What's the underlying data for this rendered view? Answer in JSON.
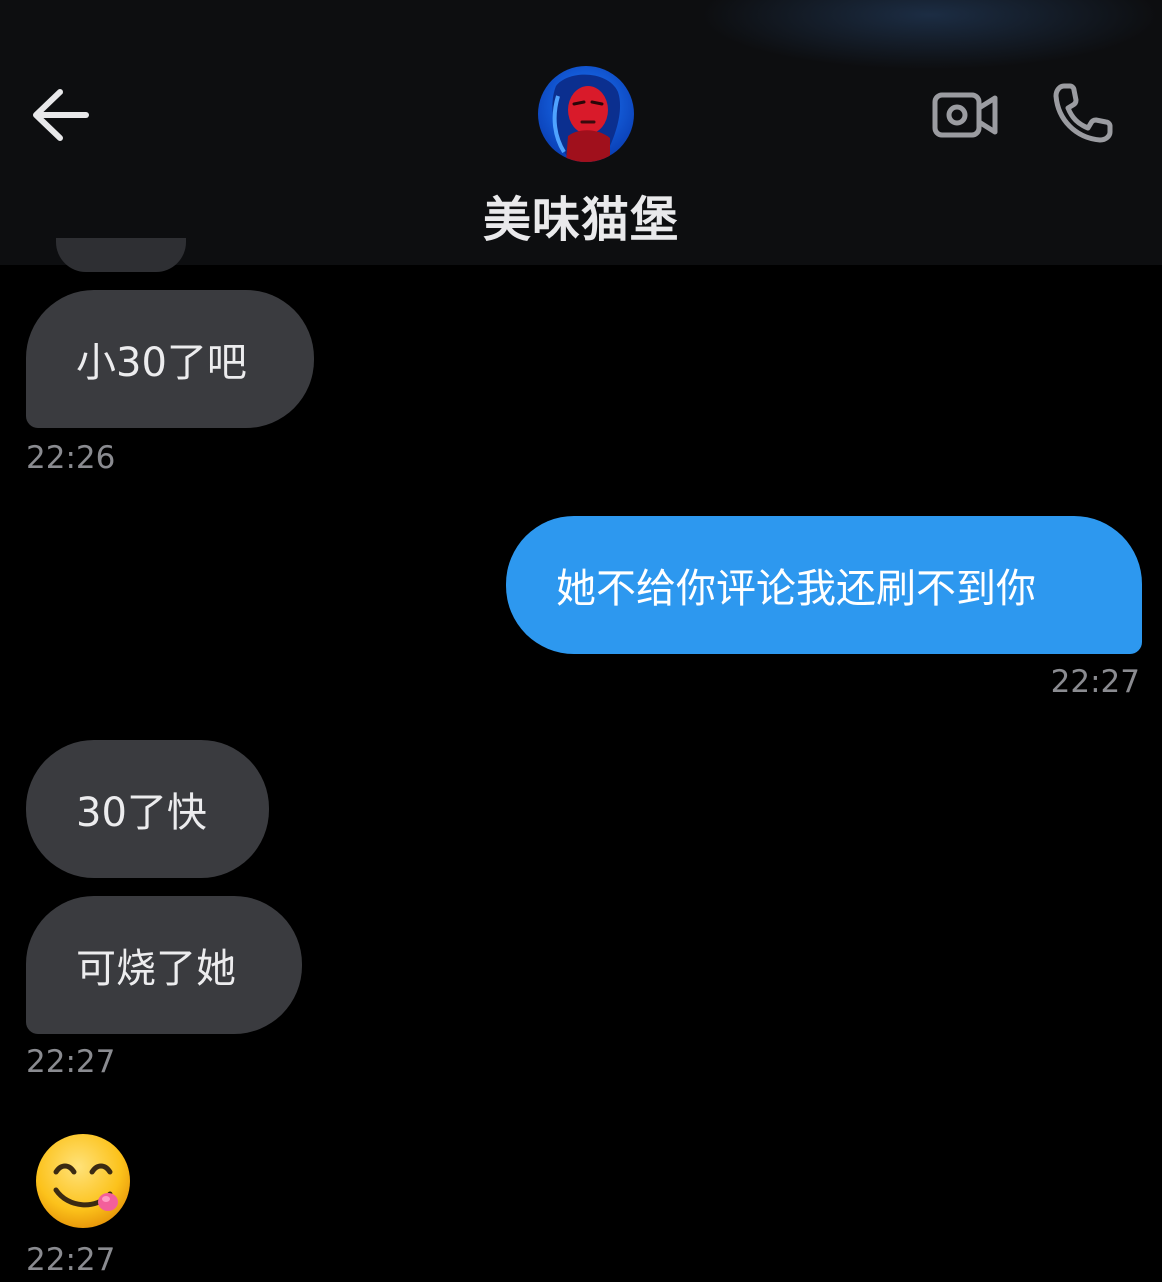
{
  "header": {
    "contact_name": "美味猫堡",
    "back_icon": "arrow-left-icon",
    "video_icon": "video-camera-icon",
    "phone_icon": "phone-icon"
  },
  "messages": [
    {
      "direction": "incoming",
      "text": "小30了吧",
      "time": "22:26"
    },
    {
      "direction": "outgoing",
      "text": "她不给你评论我还刷不到你",
      "time": "22:27"
    },
    {
      "direction": "incoming",
      "text": "30了快"
    },
    {
      "direction": "incoming",
      "text": "可烧了她",
      "time": "22:27"
    },
    {
      "direction": "incoming",
      "emoji": "yum-face-emoji",
      "time": "22:27"
    }
  ],
  "colors": {
    "background": "#000000",
    "header": "#0d0e10",
    "incoming_bubble": "#3a3b3f",
    "outgoing_bubble": "#2d98ef",
    "timestamp": "#8a8b90"
  }
}
